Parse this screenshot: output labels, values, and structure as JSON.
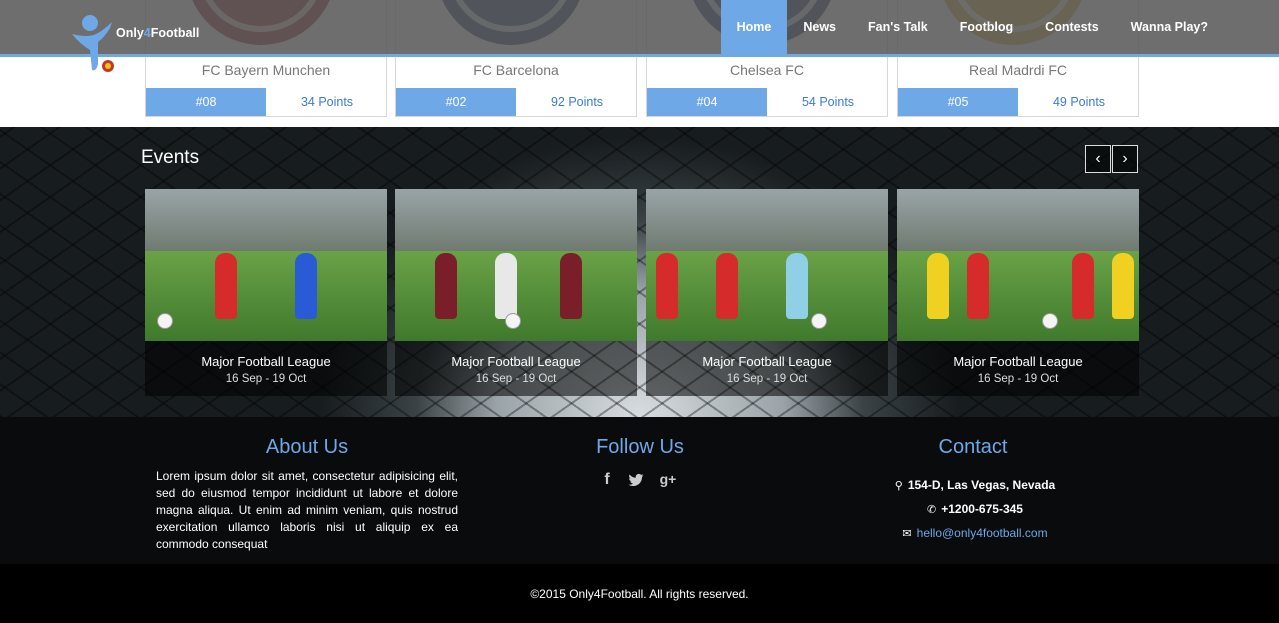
{
  "brand": {
    "name_part1": "Only",
    "name_part2": "4",
    "name_part3": "Football"
  },
  "nav": {
    "items": [
      {
        "label": "Home",
        "active": true
      },
      {
        "label": "News",
        "active": false
      },
      {
        "label": "Fan's Talk",
        "active": false
      },
      {
        "label": "Footblog",
        "active": false
      },
      {
        "label": "Contests",
        "active": false
      },
      {
        "label": "Wanna Play?",
        "active": false
      }
    ]
  },
  "teams": [
    {
      "name": "FC Bayern Munchen",
      "rank": "#08",
      "points": "34 Points"
    },
    {
      "name": "FC Barcelona",
      "rank": "#02",
      "points": "92 Points"
    },
    {
      "name": "Chelsea FC",
      "rank": "#04",
      "points": "54 Points"
    },
    {
      "name": "Real Madrdi FC",
      "rank": "#05",
      "points": "49 Points"
    }
  ],
  "events": {
    "title": "Events",
    "prev_icon": "chevron-left-icon",
    "next_icon": "chevron-right-icon",
    "items": [
      {
        "name": "Major Football League",
        "date": "16 Sep - 19 Oct"
      },
      {
        "name": "Major Football League",
        "date": "16 Sep - 19 Oct"
      },
      {
        "name": "Major Football League",
        "date": "16 Sep - 19 Oct"
      },
      {
        "name": "Major Football League",
        "date": "16 Sep - 19 Oct"
      }
    ]
  },
  "about": {
    "title": "About Us",
    "text": "Lorem ipsum dolor sit amet, consectetur adipisicing elit, sed do eiusmod tempor incididunt ut labore et dolore magna aliqua. Ut enim ad minim veniam, quis nostrud exercitation ullamco laboris nisi ut aliquip ex ea commodo consequat"
  },
  "follow": {
    "title": "Follow Us",
    "icons": [
      "facebook-icon",
      "twitter-icon",
      "google-plus-icon"
    ]
  },
  "contact": {
    "title": "Contact",
    "address": "154-D, Las Vegas, Nevada",
    "phone": "+1200-675-345",
    "email": "hello@only4football.com"
  },
  "footer": {
    "copyright": "©2015 Only4Football.  All rights reserved."
  },
  "colors": {
    "accent": "#6fa8e6",
    "header_bg": "#5a5a5a",
    "footer_bg": "#000000"
  }
}
